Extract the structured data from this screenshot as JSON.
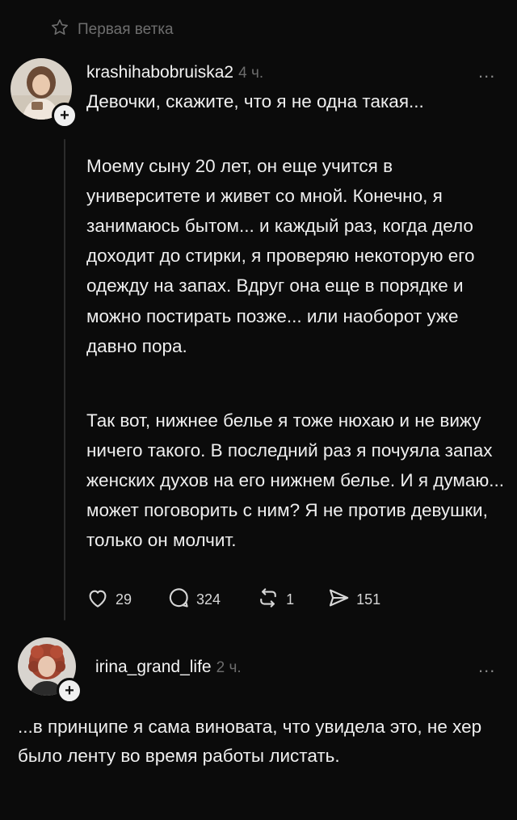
{
  "thread_label": "Первая ветка",
  "post": {
    "username": "krashihabobruiska2",
    "time": "4 ч.",
    "title": "Девочки, скажите, что я не одна такая...",
    "paragraphs": [
      "Моему сыну 20 лет, он еще учится в университете и живет со мной. Конечно, я занимаюсь бытом... и каждый раз, когда дело доходит до стирки, я проверяю некоторую его одежду на запах. Вдруг она еще в порядке и можно постирать позже... или наоборот уже давно пора.",
      "Так вот, нижнее белье я тоже нюхаю и не вижу ничего такого. В последний раз я почуяла запах женских духов на его нижнем белье. И я думаю... может поговорить с ним? Я не против девушки, только он молчит."
    ],
    "likes": "29",
    "comments": "324",
    "reposts": "1",
    "shares": "151"
  },
  "reply": {
    "username": "irina_grand_life",
    "time": "2 ч.",
    "text": "...в принципе я сама виновата, что увидела это, не хер было ленту во время работы листать."
  },
  "more_label": "..."
}
